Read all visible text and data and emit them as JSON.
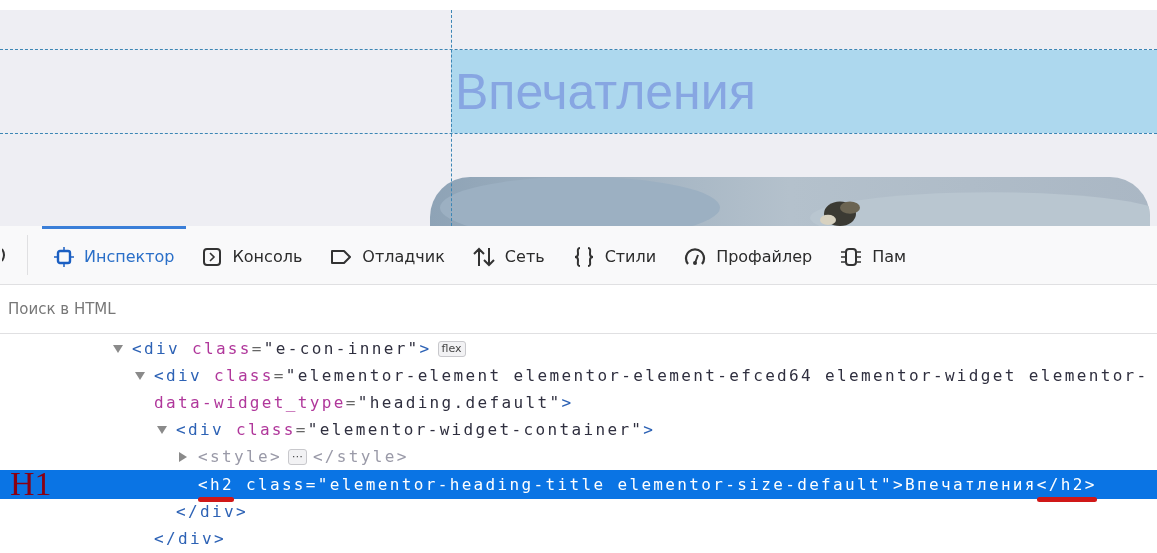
{
  "page_preview": {
    "heading": "Впечатления"
  },
  "toolbar": {
    "tabs": [
      {
        "label": "Инспектор",
        "kind": "inspector",
        "selected": true
      },
      {
        "label": "Консоль",
        "kind": "console",
        "selected": false
      },
      {
        "label": "Отладчик",
        "kind": "debugger",
        "selected": false
      },
      {
        "label": "Сеть",
        "kind": "network",
        "selected": false
      },
      {
        "label": "Стили",
        "kind": "style",
        "selected": false
      },
      {
        "label": "Профайлер",
        "kind": "performance",
        "selected": false
      },
      {
        "label": "Пам",
        "kind": "memory",
        "selected": false
      }
    ]
  },
  "search": {
    "placeholder": "Поиск в HTML"
  },
  "annotation": {
    "label": "H1"
  },
  "markup_tree": [
    {
      "expanded": true,
      "selected": false,
      "lines": [
        [
          {
            "kind": "tag",
            "text": "<div"
          },
          {
            "kind": "attr",
            "text": " class"
          },
          {
            "kind": "punct",
            "text": "="
          },
          {
            "kind": "value",
            "text": "\"e-con-inner\""
          },
          {
            "kind": "tag",
            "text": ">"
          }
        ]
      ],
      "badge": "flex",
      "children": [
        {
          "expanded": true,
          "selected": false,
          "lines": [
            [
              {
                "kind": "tag",
                "text": "<div"
              },
              {
                "kind": "attr",
                "text": " class"
              },
              {
                "kind": "punct",
                "text": "="
              },
              {
                "kind": "value",
                "text": "\"elementor-element elementor-element-efced64 elementor-widget elementor-"
              }
            ],
            [
              {
                "kind": "attr",
                "text": "data-widget_type"
              },
              {
                "kind": "punct",
                "text": "="
              },
              {
                "kind": "value",
                "text": "\"heading.default\""
              },
              {
                "kind": "tag",
                "text": ">"
              }
            ]
          ],
          "children": [
            {
              "expanded": true,
              "selected": false,
              "lines": [
                [
                  {
                    "kind": "tag",
                    "text": "<div"
                  },
                  {
                    "kind": "attr",
                    "text": " class"
                  },
                  {
                    "kind": "punct",
                    "text": "="
                  },
                  {
                    "kind": "value",
                    "text": "\"elementor-widget-container\""
                  },
                  {
                    "kind": "tag",
                    "text": ">"
                  }
                ]
              ],
              "children": [
                {
                  "expanded": false,
                  "selected": false,
                  "lines": [
                    [
                      {
                        "kind": "faded",
                        "text": "<style>"
                      }
                    ]
                  ],
                  "badge": "⋯",
                  "after": [
                    {
                      "kind": "faded",
                      "text": "</style>"
                    }
                  ]
                },
                {
                  "selected": true,
                  "annotated": true,
                  "lines": [
                    [
                      {
                        "kind": "tag",
                        "text": "<h2",
                        "underlined": true
                      },
                      {
                        "kind": "attr",
                        "text": " class"
                      },
                      {
                        "kind": "punct",
                        "text": "="
                      },
                      {
                        "kind": "value",
                        "text": "\"elementor-heading-title elementor-size-default\""
                      },
                      {
                        "kind": "tag",
                        "text": ">"
                      },
                      {
                        "kind": "text",
                        "text": "Впечатления"
                      },
                      {
                        "kind": "tag",
                        "text": "</h2>",
                        "underlined": true
                      }
                    ]
                  ]
                }
              ],
              "closing": "</div>"
            }
          ],
          "closing": "</div>"
        }
      ]
    }
  ]
}
